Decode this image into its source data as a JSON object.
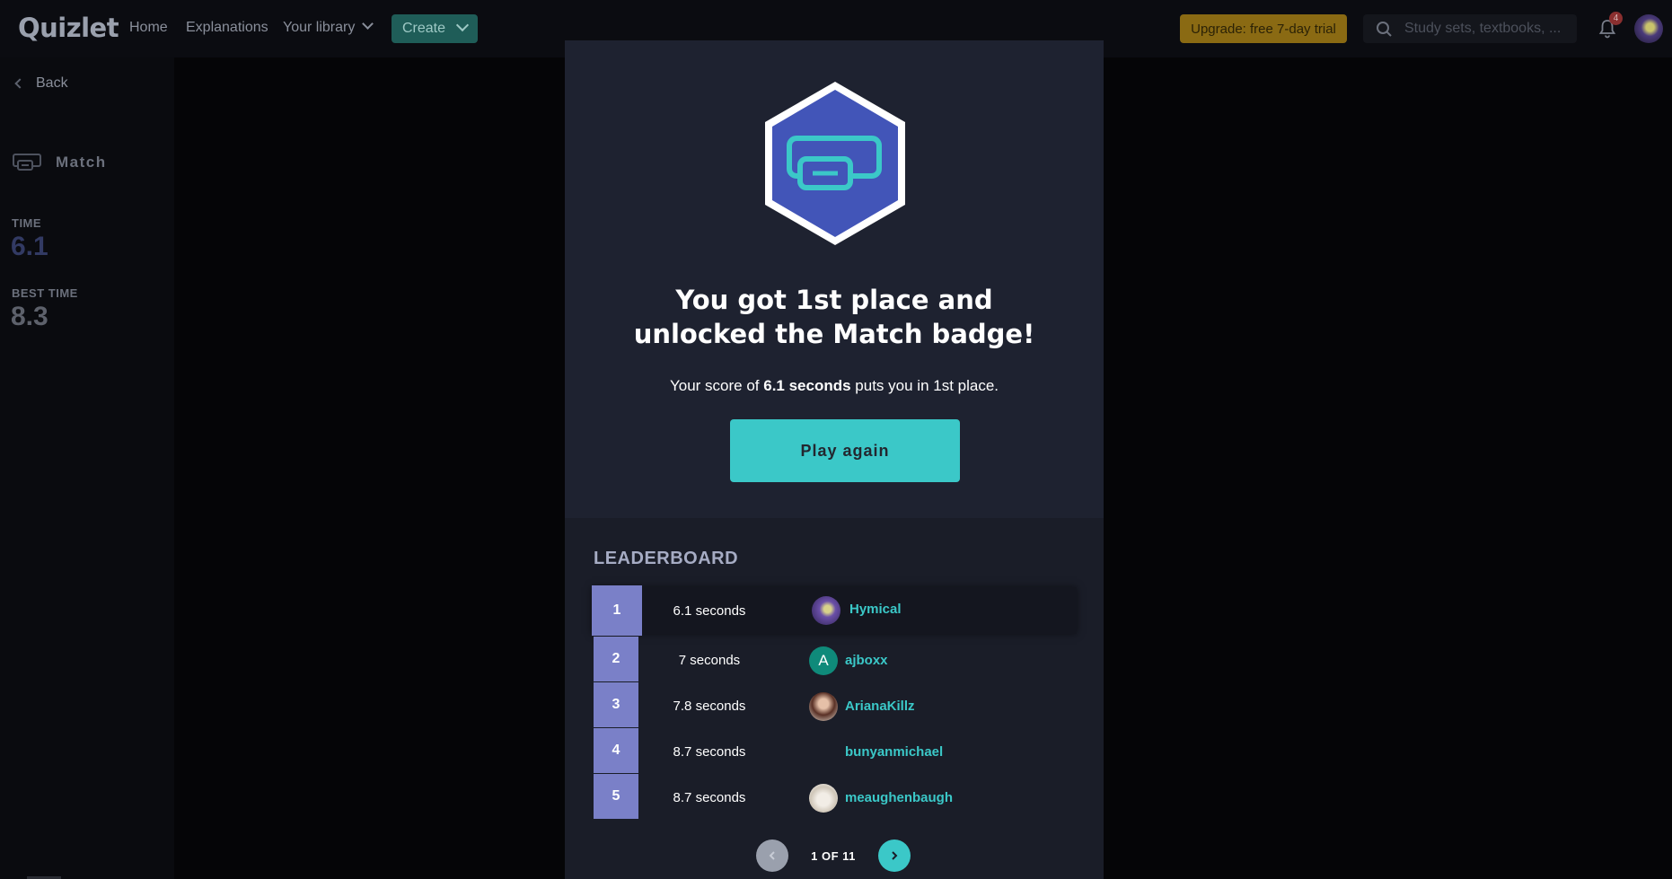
{
  "header": {
    "logo": "Quizlet",
    "nav": {
      "home": "Home",
      "explanations": "Explanations",
      "library": "Your library",
      "create": "Create"
    },
    "upgrade": "Upgrade: free 7-day trial",
    "search_placeholder": "Study sets, textbooks, ...",
    "notification_count": "4"
  },
  "sidebar": {
    "back": "Back",
    "mode": "Match",
    "time_label": "TIME",
    "time_value": "6.1",
    "best_label": "BEST TIME",
    "best_value": "8.3"
  },
  "modal": {
    "headline_line1": "You got 1st place and",
    "headline_line2": "unlocked the Match badge!",
    "score_prefix": "Your score of ",
    "score_bold": "6.1 seconds",
    "score_suffix": " puts you in 1st place.",
    "play_again": "Play again",
    "leaderboard_title": "LEADERBOARD",
    "leaderboard": [
      {
        "rank": "1",
        "time": "6.1 seconds",
        "name": "Hymical",
        "avatar": "photo",
        "avatar_color": "#4a3a7a"
      },
      {
        "rank": "2",
        "time": "7 seconds",
        "name": "ajboxx",
        "avatar": "letter",
        "avatar_letter": "A",
        "avatar_color": "#0f8a7a"
      },
      {
        "rank": "3",
        "time": "7.8 seconds",
        "name": "ArianaKillz",
        "avatar": "photo",
        "avatar_color": "#c79a82"
      },
      {
        "rank": "4",
        "time": "8.7 seconds",
        "name": "bunyanmichael",
        "avatar": "none",
        "avatar_color": ""
      },
      {
        "rank": "5",
        "time": "8.7 seconds",
        "name": "meaughenbaugh",
        "avatar": "photo",
        "avatar_color": "#e4ddd2"
      }
    ],
    "pager": "1 OF 11"
  },
  "colors": {
    "accent": "#3bc8c8",
    "rank_badge": "#7a80c8",
    "badge_hex": "#4255b8",
    "modal_bg": "#1e2230"
  }
}
